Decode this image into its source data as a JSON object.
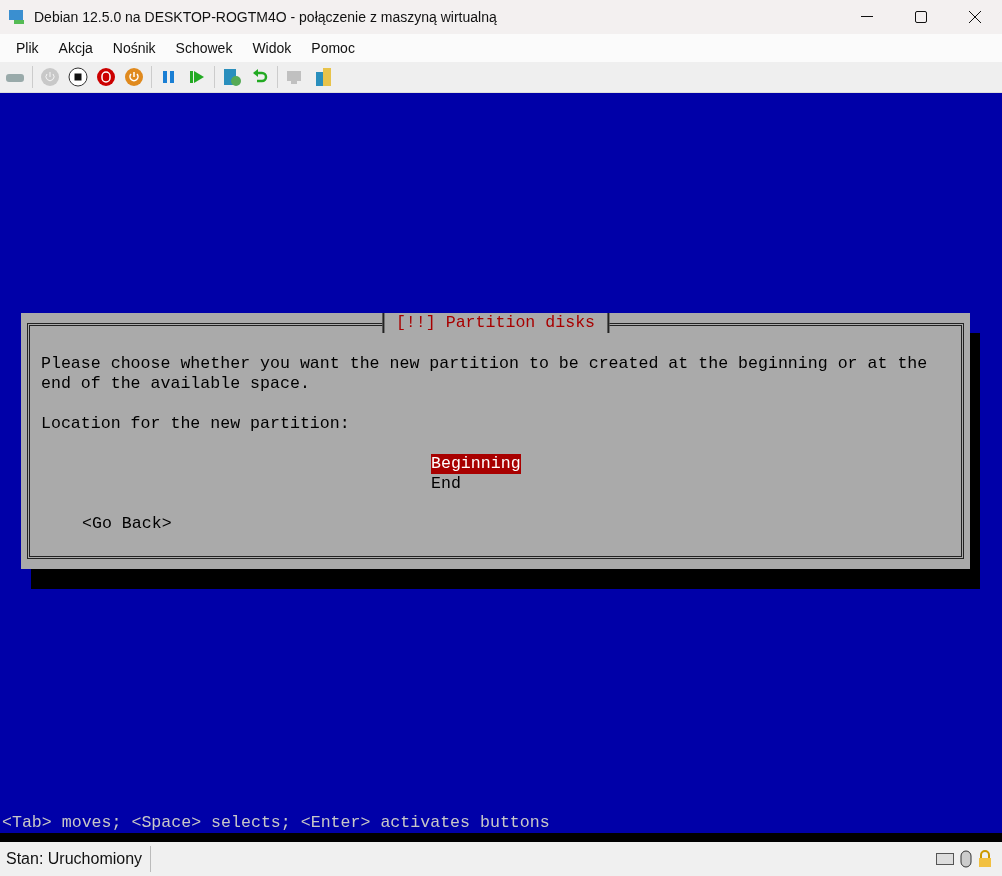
{
  "window": {
    "title": "Debian 12.5.0 na DESKTOP-ROGTM4O - połączenie z maszyną wirtualną"
  },
  "menu": [
    "Plik",
    "Akcja",
    "Nośnik",
    "Schowek",
    "Widok",
    "Pomoc"
  ],
  "toolbar": [
    {
      "kind": "keyboard",
      "disabled": false
    },
    {
      "kind": "sep"
    },
    {
      "kind": "start",
      "disabled": true
    },
    {
      "kind": "stop",
      "disabled": false
    },
    {
      "kind": "shutdown",
      "disabled": false
    },
    {
      "kind": "save",
      "disabled": false
    },
    {
      "kind": "sep"
    },
    {
      "kind": "pause",
      "disabled": false
    },
    {
      "kind": "resume",
      "disabled": false
    },
    {
      "kind": "sep"
    },
    {
      "kind": "checkpoint",
      "disabled": false
    },
    {
      "kind": "revert",
      "disabled": false
    },
    {
      "kind": "sep"
    },
    {
      "kind": "session",
      "disabled": true
    },
    {
      "kind": "share",
      "disabled": false
    }
  ],
  "dialog": {
    "title": "[!!] Partition disks",
    "text": "Please choose whether you want the new partition to be created at the beginning or at the end of the available space.",
    "prompt": "Location for the new partition:",
    "options": [
      {
        "label": "Beginning",
        "selected": true
      },
      {
        "label": "End",
        "selected": false
      }
    ],
    "back_button": "<Go Back>"
  },
  "hint": "<Tab> moves; <Space> selects; <Enter> activates buttons",
  "status": "Stan: Uruchomiony"
}
